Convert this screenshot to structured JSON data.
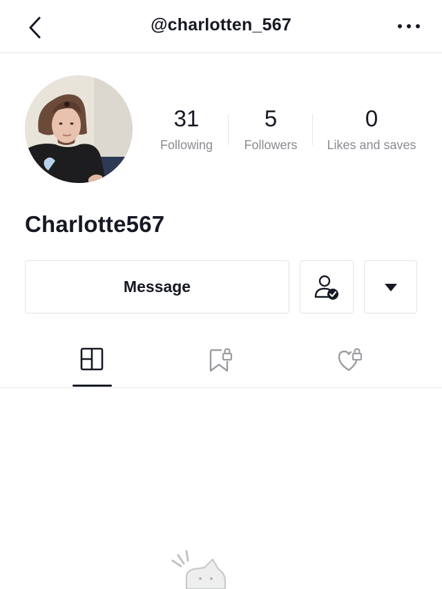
{
  "header": {
    "handle": "@charlotten_567",
    "back_icon": "chevron-left-icon",
    "more_icon": "more-horizontal-icon"
  },
  "profile": {
    "display_name": "Charlotte567",
    "avatar": "profile-photo"
  },
  "stats": [
    {
      "value": "31",
      "label": "Following"
    },
    {
      "value": "5",
      "label": "Followers"
    },
    {
      "value": "0",
      "label": "Likes and saves"
    }
  ],
  "actions": {
    "message_label": "Message",
    "friend_icon": "user-check-icon",
    "dropdown_icon": "caret-down-icon"
  },
  "tabs": [
    {
      "icon": "grid-layout-icon",
      "active": true
    },
    {
      "icon": "bookmark-lock-icon",
      "active": false
    },
    {
      "icon": "heart-lock-icon",
      "active": false
    }
  ],
  "colors": {
    "text_primary": "#161823",
    "text_secondary": "#8a8b91",
    "divider": "#e3e3e4",
    "icon_gray": "#9b9ca1"
  }
}
